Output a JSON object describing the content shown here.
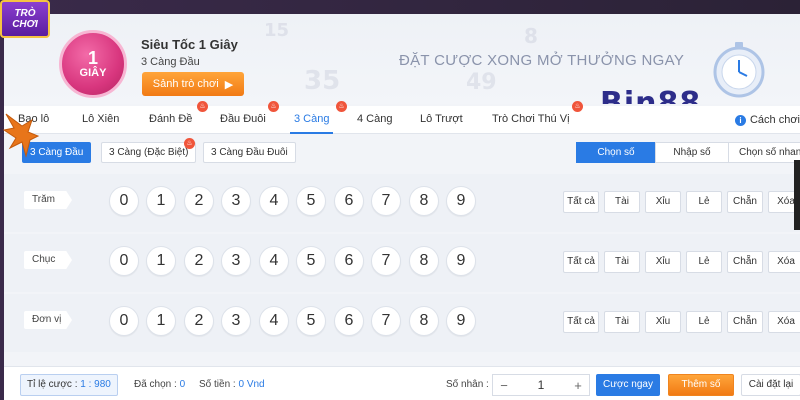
{
  "logo": {
    "line1": "TRÒ",
    "line2": "CHƠI"
  },
  "header": {
    "badge_number": "1",
    "badge_unit": "GIÂY",
    "title": "Siêu Tốc 1 Giây",
    "subtitle": "3 Càng Đầu",
    "lobby_button": "Sảnh trò chơi",
    "slogan": "ĐẶT CƯỢC XONG MỞ THƯỞNG NGAY",
    "brand": "Bin88",
    "bg_numbers": [
      "49",
      "35",
      "8",
      "15"
    ]
  },
  "tabs": [
    {
      "label": "Bao lô",
      "hot": false
    },
    {
      "label": "Lô Xiên",
      "hot": false
    },
    {
      "label": "Đánh Đề",
      "hot": true
    },
    {
      "label": "Đầu Đuôi",
      "hot": true
    },
    {
      "label": "3 Càng",
      "hot": true,
      "active": true
    },
    {
      "label": "4 Càng",
      "hot": false
    },
    {
      "label": "Lô Trượt",
      "hot": false
    },
    {
      "label": "Trò Chơi Thú Vị",
      "hot": true
    }
  ],
  "rules_label": "Cách chơi",
  "subtabs": [
    {
      "label": "3 Càng Đầu",
      "active": true
    },
    {
      "label": "3 Càng (Đặc Biệt)"
    },
    {
      "label": "3 Càng Đầu Đuôi"
    }
  ],
  "modes": [
    "Chọn số",
    "Nhập số",
    "Chọn số nhanh"
  ],
  "rows": [
    {
      "label": "Trăm"
    },
    {
      "label": "Chục"
    },
    {
      "label": "Đơn vị"
    }
  ],
  "digits": [
    "0",
    "1",
    "2",
    "3",
    "4",
    "5",
    "6",
    "7",
    "8",
    "9"
  ],
  "quick": [
    "Tất cả",
    "Tài",
    "Xỉu",
    "Lẻ",
    "Chẵn",
    "Xóa"
  ],
  "footer": {
    "odds_label": "Tỉ lệ cược :",
    "odds_value": "1 : 980",
    "selected_label": "Đã chọn :",
    "selected_value": "0",
    "amount_label": "Số tiền :",
    "amount_value": "0 Vnd",
    "multiplier_label": "Số nhân :",
    "multiplier_value": "1",
    "minus": "−",
    "plus": "+",
    "bet_button": "Cược ngay",
    "add_button": "Thêm số",
    "reset_button": "Cài đặt lại"
  }
}
